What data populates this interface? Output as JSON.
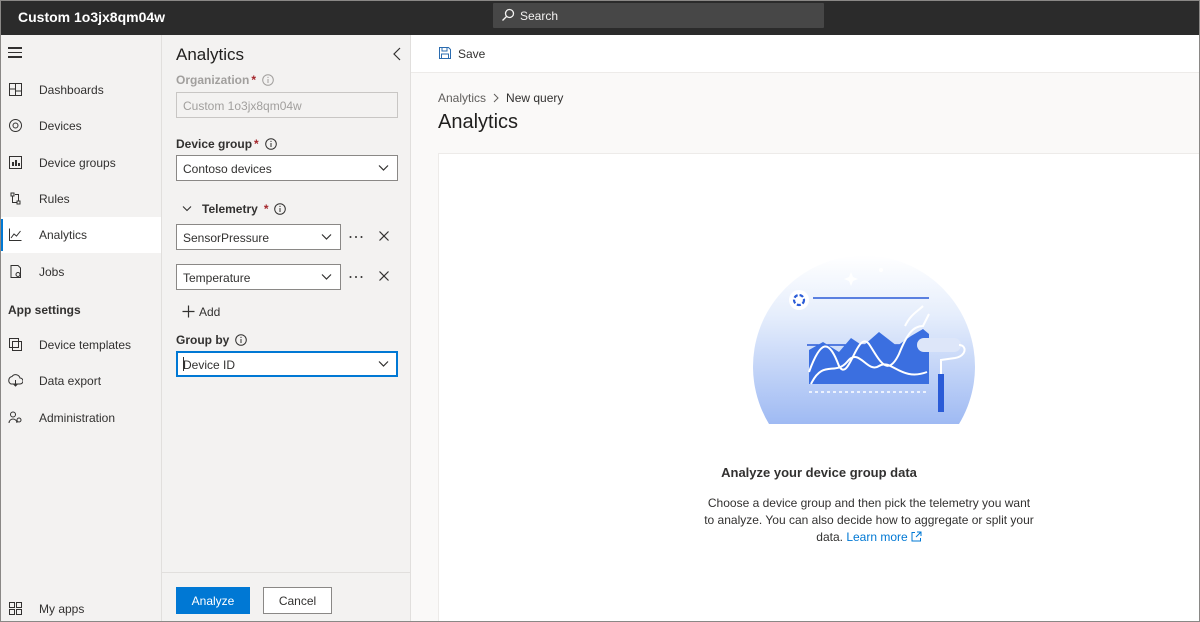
{
  "app": {
    "title": "Custom 1o3jx8qm04w"
  },
  "search": {
    "label": "Search"
  },
  "nav": {
    "items": [
      {
        "label": "Dashboards",
        "icon": "dashboard-icon"
      },
      {
        "label": "Devices",
        "icon": "devices-icon"
      },
      {
        "label": "Device groups",
        "icon": "device-groups-icon"
      },
      {
        "label": "Rules",
        "icon": "rules-icon"
      },
      {
        "label": "Analytics",
        "icon": "analytics-icon",
        "active": true
      },
      {
        "label": "Jobs",
        "icon": "jobs-icon"
      }
    ],
    "section_app_settings": "App settings",
    "settings_items": [
      {
        "label": "Device templates",
        "icon": "device-templates-icon"
      },
      {
        "label": "Data export",
        "icon": "data-export-icon"
      },
      {
        "label": "Administration",
        "icon": "administration-icon"
      }
    ],
    "my_apps": "My apps"
  },
  "panel": {
    "title": "Analytics",
    "organization": {
      "label": "Organization",
      "required": "*",
      "value": "Custom 1o3jx8qm04w"
    },
    "device_group": {
      "label": "Device group",
      "required": "*",
      "value": "Contoso devices"
    },
    "telemetry": {
      "label": "Telemetry",
      "required": "*",
      "items": [
        {
          "value": "SensorPressure"
        },
        {
          "value": "Temperature"
        }
      ],
      "add_label": "Add"
    },
    "group_by": {
      "label": "Group by",
      "value": "Device ID"
    },
    "analyze_button": "Analyze",
    "cancel_button": "Cancel"
  },
  "main": {
    "save_label": "Save",
    "breadcrumb": {
      "root": "Analytics",
      "current": "New query"
    },
    "title": "Analytics",
    "empty": {
      "title": "Analyze your device group data",
      "description": "Choose a device group and then pick the telemetry you want to analyze. You can also decide how to aggregate or split your data.",
      "learn_more": "Learn more"
    }
  },
  "colors": {
    "accent": "#0078d4",
    "topbar": "#2b2b2b",
    "nav_bg": "#f3f2f1"
  }
}
